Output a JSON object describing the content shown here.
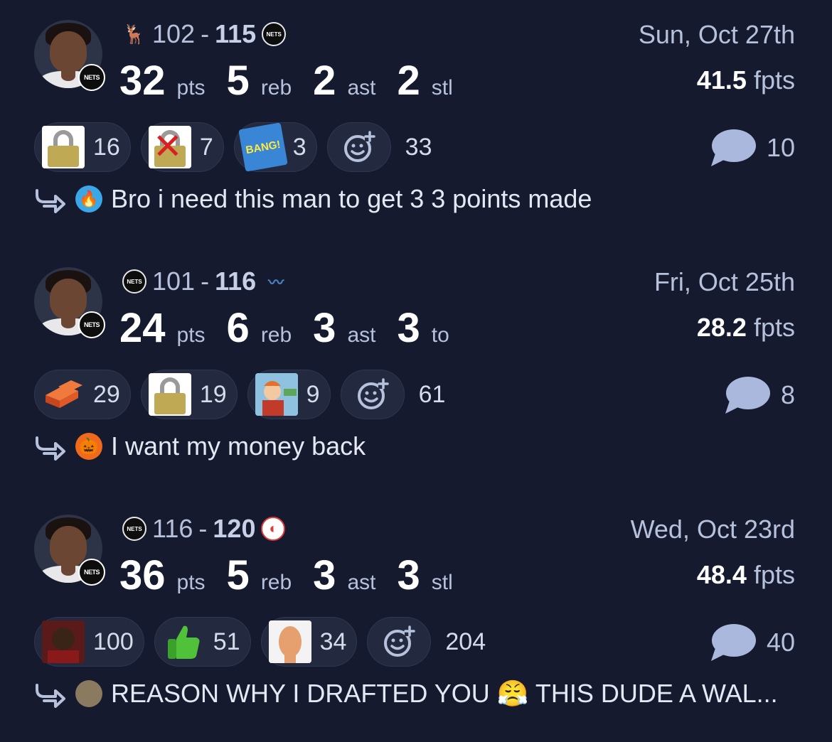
{
  "games": [
    {
      "away_logo": "bucks-logo",
      "home_logo": "nets-logo",
      "score_left": "102",
      "score_sep": "-",
      "score_right": "115",
      "stats": [
        {
          "value": "32",
          "unit": "pts"
        },
        {
          "value": "5",
          "unit": "reb"
        },
        {
          "value": "2",
          "unit": "ast"
        },
        {
          "value": "2",
          "unit": "stl"
        }
      ],
      "date": "Sun, Oct 27th",
      "fpts_value": "41.5",
      "fpts_unit": "fpts",
      "reactions": [
        {
          "emoji": "padlock",
          "count": "16"
        },
        {
          "emoji": "crossed-out-padlock",
          "count": "7"
        },
        {
          "emoji": "bang-comic",
          "count": "3"
        }
      ],
      "reaction_total": "33",
      "comment_count": "10",
      "comment_avatar": "blue-flame-avatar",
      "comment_text": "Bro i need this man to get 3 3 points made"
    },
    {
      "away_logo": "nets-logo",
      "home_logo": "magic-logo",
      "score_left": "101",
      "score_sep": "-",
      "score_right": "116",
      "stats": [
        {
          "value": "24",
          "unit": "pts"
        },
        {
          "value": "6",
          "unit": "reb"
        },
        {
          "value": "3",
          "unit": "ast"
        },
        {
          "value": "3",
          "unit": "to"
        }
      ],
      "date": "Fri, Oct 25th",
      "fpts_value": "28.2",
      "fpts_unit": "fpts",
      "reactions": [
        {
          "emoji": "bricks",
          "count": "29"
        },
        {
          "emoji": "padlock",
          "count": "19"
        },
        {
          "emoji": "fry-money",
          "count": "9"
        }
      ],
      "reaction_total": "61",
      "comment_count": "8",
      "comment_avatar": "orange-pumpkin-avatar",
      "comment_text": "I want my money back"
    },
    {
      "away_logo": "nets-logo",
      "home_logo": "hawks-logo",
      "score_left": "116",
      "score_sep": "-",
      "score_right": "120",
      "stats": [
        {
          "value": "36",
          "unit": "pts"
        },
        {
          "value": "5",
          "unit": "reb"
        },
        {
          "value": "3",
          "unit": "ast"
        },
        {
          "value": "3",
          "unit": "stl"
        }
      ],
      "date": "Wed, Oct 23rd",
      "fpts_value": "48.4",
      "fpts_unit": "fpts",
      "reactions": [
        {
          "emoji": "lebron-photo",
          "count": "100"
        },
        {
          "emoji": "green-thumbs-up",
          "count": "51"
        },
        {
          "emoji": "bald-man-photo",
          "count": "34"
        }
      ],
      "reaction_total": "204",
      "comment_count": "40",
      "comment_avatar": "photo-avatar",
      "comment_text": "REASON WHY I DRAFTED YOU 😤 THIS DUDE A WAL..."
    }
  ],
  "team_badge_text": "NETS",
  "colors": {
    "background": "#151a2e",
    "pill": "#232a40",
    "muted_text": "#b6c1dc",
    "comment_bubble": "#a9b8dc"
  }
}
